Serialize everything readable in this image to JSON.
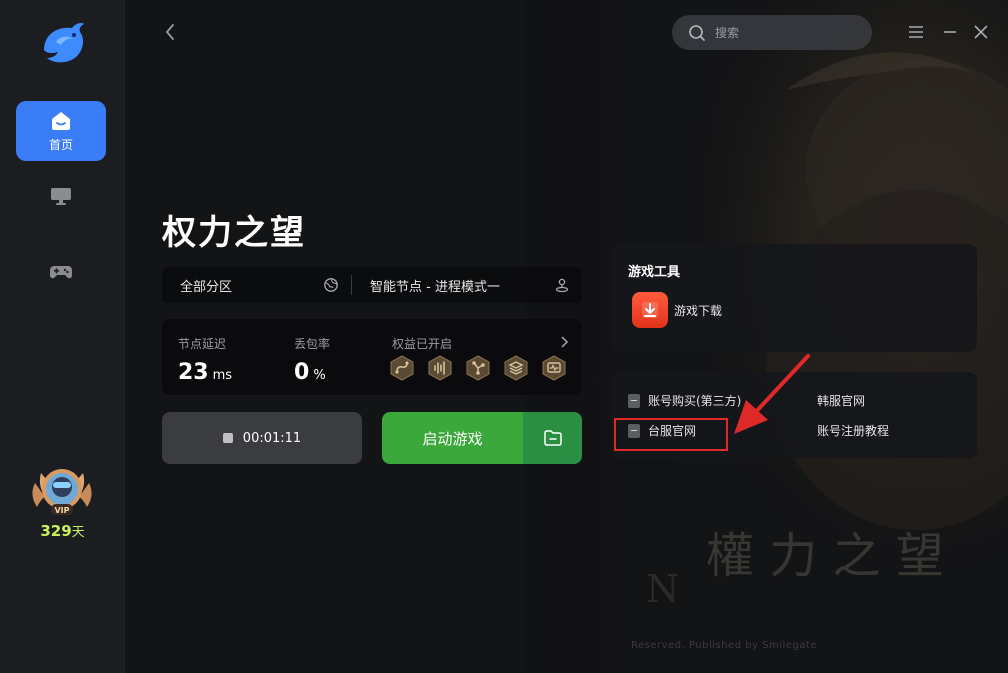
{
  "app": {
    "name": "dolphin-accelerator",
    "colors": {
      "sidebar_bg": "#1c1d21",
      "active_nav": "#3b7cf7",
      "launch_green": "#3aa83a",
      "vip_days": "#c9f25c",
      "highlight": "#e02a2a"
    }
  },
  "sidebar": {
    "items": [
      {
        "label": "首页",
        "icon": "home-icon",
        "active": true
      },
      {
        "label": "",
        "icon": "monitor-icon",
        "active": false
      },
      {
        "label": "",
        "icon": "gamepad-icon",
        "active": false
      }
    ],
    "vip": {
      "badge_text": "VIP",
      "days": "329",
      "unit": "天"
    }
  },
  "header": {
    "search": {
      "placeholder": "搜索"
    },
    "controls": [
      "menu-icon",
      "minimize-icon",
      "close-icon"
    ]
  },
  "game": {
    "title": "权力之望",
    "region": "全部分区",
    "node": "智能节点 - 进程模式一",
    "stats": {
      "latency_label": "节点延迟",
      "latency_value": "23",
      "latency_unit": "ms",
      "loss_label": "丢包率",
      "loss_value": "0",
      "loss_unit": "%",
      "rights_label": "权益已开启",
      "rights_icons": [
        "route-icon",
        "audio-wave-icon",
        "branch-icon",
        "layers-icon",
        "monitor-pulse-icon"
      ]
    },
    "timer": "00:01:11",
    "launch_label": "启动游戏"
  },
  "tools": {
    "title": "游戏工具",
    "items": [
      {
        "label": "游戏下载",
        "icon": "download-icon"
      }
    ]
  },
  "links": {
    "items": [
      {
        "label": "账号购买(第三方)",
        "icon": "doc-icon"
      },
      {
        "label": "韩服官网",
        "icon": ""
      },
      {
        "label": "台服官网",
        "icon": "doc-icon"
      },
      {
        "label": "账号注册教程",
        "icon": ""
      }
    ]
  },
  "background": {
    "logo_text": "權 力 之 望",
    "copyright": "Reserved. Published by Smilegate"
  }
}
